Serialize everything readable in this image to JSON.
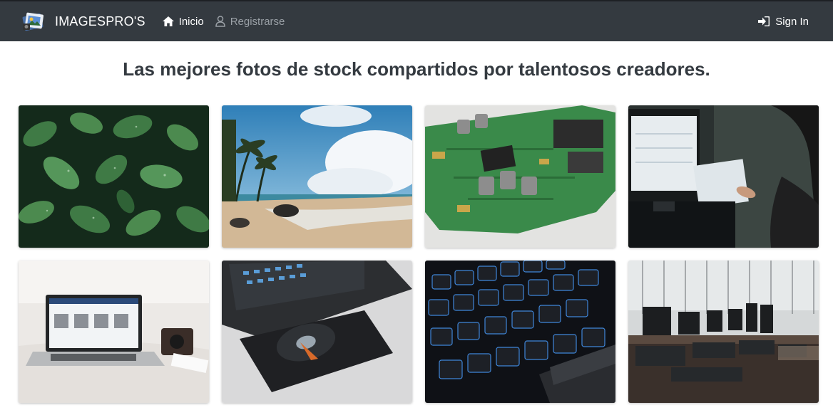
{
  "navbar": {
    "brand": "IMAGESPRO'S",
    "links": [
      {
        "label": "Inicio",
        "icon": "home-icon",
        "active": true
      },
      {
        "label": "Registrarse",
        "icon": "user-icon",
        "active": false
      }
    ],
    "signin": {
      "label": "Sign In",
      "icon": "sign-in-icon"
    }
  },
  "headline": "Las mejores fotos de stock compartidos por talentosos creadores.",
  "gallery": [
    {
      "subject": "green-leaves"
    },
    {
      "subject": "tropical-beach"
    },
    {
      "subject": "circuit-board"
    },
    {
      "subject": "computer-monitor-office"
    },
    {
      "subject": "laptop-on-bed"
    },
    {
      "subject": "laptop-optical-drive"
    },
    {
      "subject": "backlit-keyboard"
    },
    {
      "subject": "computer-lab"
    }
  ],
  "colors": {
    "navbar": "#343a40",
    "text": "#343a40",
    "muted": "#9aa0a6"
  }
}
